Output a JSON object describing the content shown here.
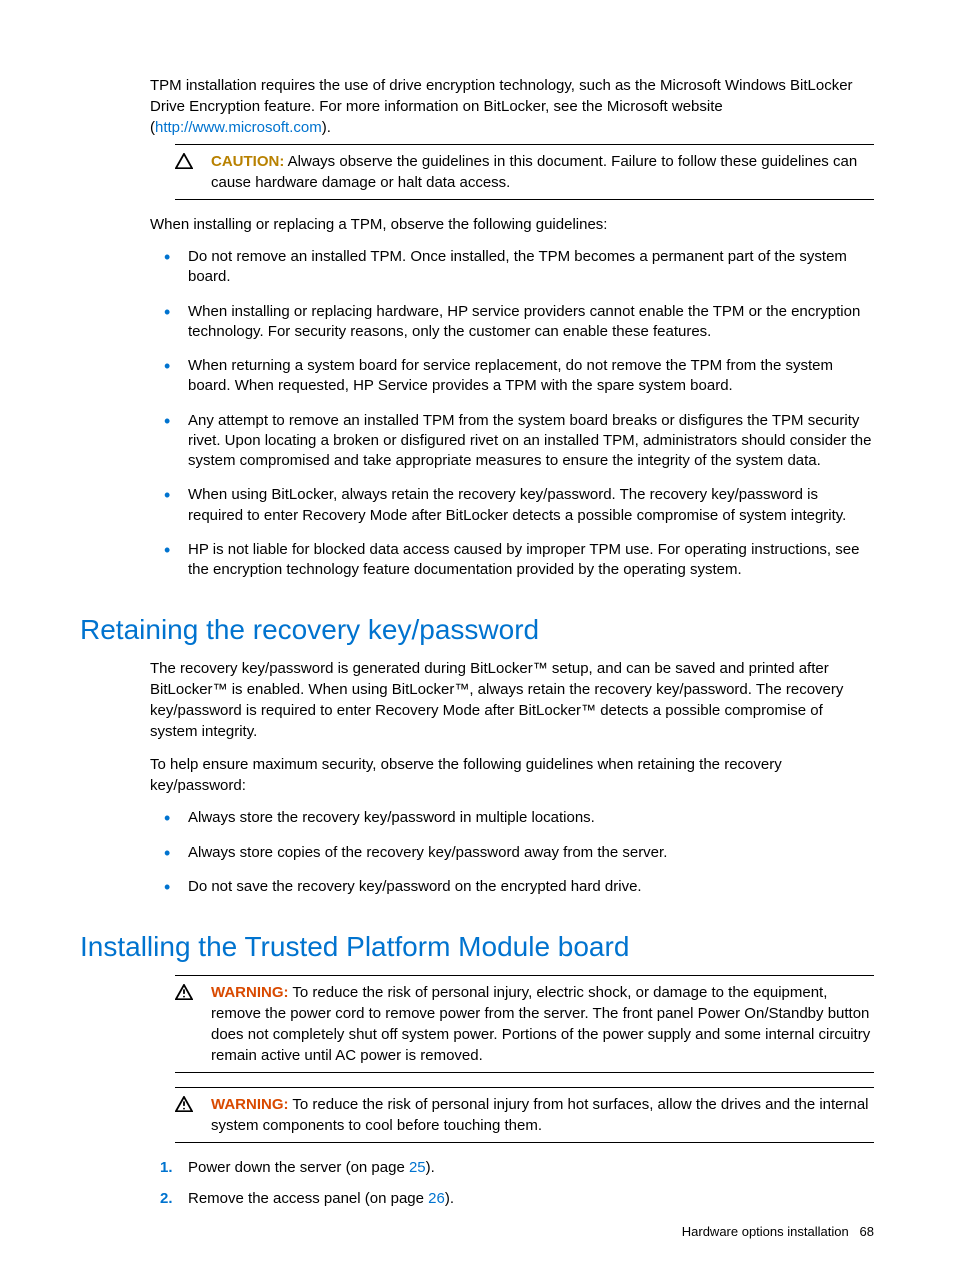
{
  "intro": {
    "p1a": "TPM installation requires the use of drive encryption technology, such as the Microsoft Windows BitLocker Drive Encryption feature. For more information on BitLocker, see the Microsoft website (",
    "link": "http://www.microsoft.com",
    "p1b": ")."
  },
  "caution": {
    "label": "CAUTION:",
    "text": "  Always observe the guidelines in this document. Failure to follow these guidelines can cause hardware damage or halt data access."
  },
  "guidelines_intro": "When installing or replacing a TPM, observe the following guidelines:",
  "guidelines": [
    "Do not remove an installed TPM. Once installed, the TPM becomes a permanent part of the system board.",
    "When installing or replacing hardware, HP service providers cannot enable the TPM or the encryption technology. For security reasons, only the customer can enable these features.",
    "When returning a system board for service replacement, do not remove the TPM from the system board. When requested, HP Service provides a TPM with the spare system board.",
    "Any attempt to remove an installed TPM from the system board breaks or disfigures the TPM security rivet. Upon locating a broken or disfigured rivet on an installed TPM, administrators should consider the system compromised and take appropriate measures to ensure the integrity of the system data.",
    "When using BitLocker, always retain the recovery key/password. The recovery key/password is required to enter Recovery Mode after BitLocker detects a possible compromise of system integrity.",
    "HP is not liable for blocked data access caused by improper TPM use. For operating instructions, see the encryption technology feature documentation provided by the operating system."
  ],
  "section1": {
    "title": "Retaining the recovery key/password",
    "p1": "The recovery key/password is generated during BitLocker™ setup, and can be saved and printed after BitLocker™ is enabled. When using BitLocker™, always retain the recovery key/password. The recovery key/password is required to enter Recovery Mode after BitLocker™ detects a possible compromise of system integrity.",
    "p2": "To help ensure maximum security, observe the following guidelines when retaining the recovery key/password:",
    "bullets": [
      "Always store the recovery key/password in multiple locations.",
      "Always store copies of the recovery key/password away from the server.",
      "Do not save the recovery key/password on the encrypted hard drive."
    ]
  },
  "section2": {
    "title": "Installing the Trusted Platform Module board",
    "warn1": {
      "label": "WARNING:",
      "text": "  To reduce the risk of personal injury, electric shock, or damage to the equipment, remove the power cord to remove power from the server. The front panel Power On/Standby button does not completely shut off system power. Portions of the power supply and some internal circuitry remain active until AC power is removed."
    },
    "warn2": {
      "label": "WARNING:",
      "text": "  To reduce the risk of personal injury from hot surfaces, allow the drives and the internal system components to cool before touching them."
    },
    "steps": [
      {
        "a": "Power down the server (on page ",
        "link": "25",
        "b": ")."
      },
      {
        "a": "Remove the access panel (on page ",
        "link": "26",
        "b": ")."
      }
    ]
  },
  "footer": {
    "section": "Hardware options installation",
    "page": "68"
  }
}
